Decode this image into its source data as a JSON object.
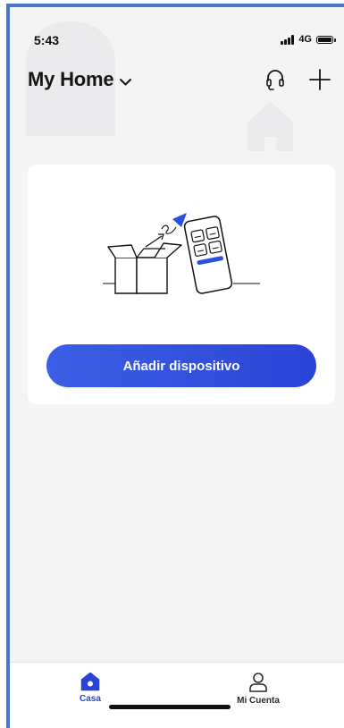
{
  "status_bar": {
    "time": "5:43",
    "network": "4G"
  },
  "header": {
    "title": "My Home"
  },
  "card": {
    "button_label": "Añadir dispositivo"
  },
  "tabbar": {
    "tabs": [
      {
        "label": "Casa",
        "active": true
      },
      {
        "label": "Mi Cuenta",
        "active": false
      }
    ]
  },
  "colors": {
    "accent": "#2a44d6",
    "background": "#f4f4f5",
    "card": "#ffffff"
  }
}
